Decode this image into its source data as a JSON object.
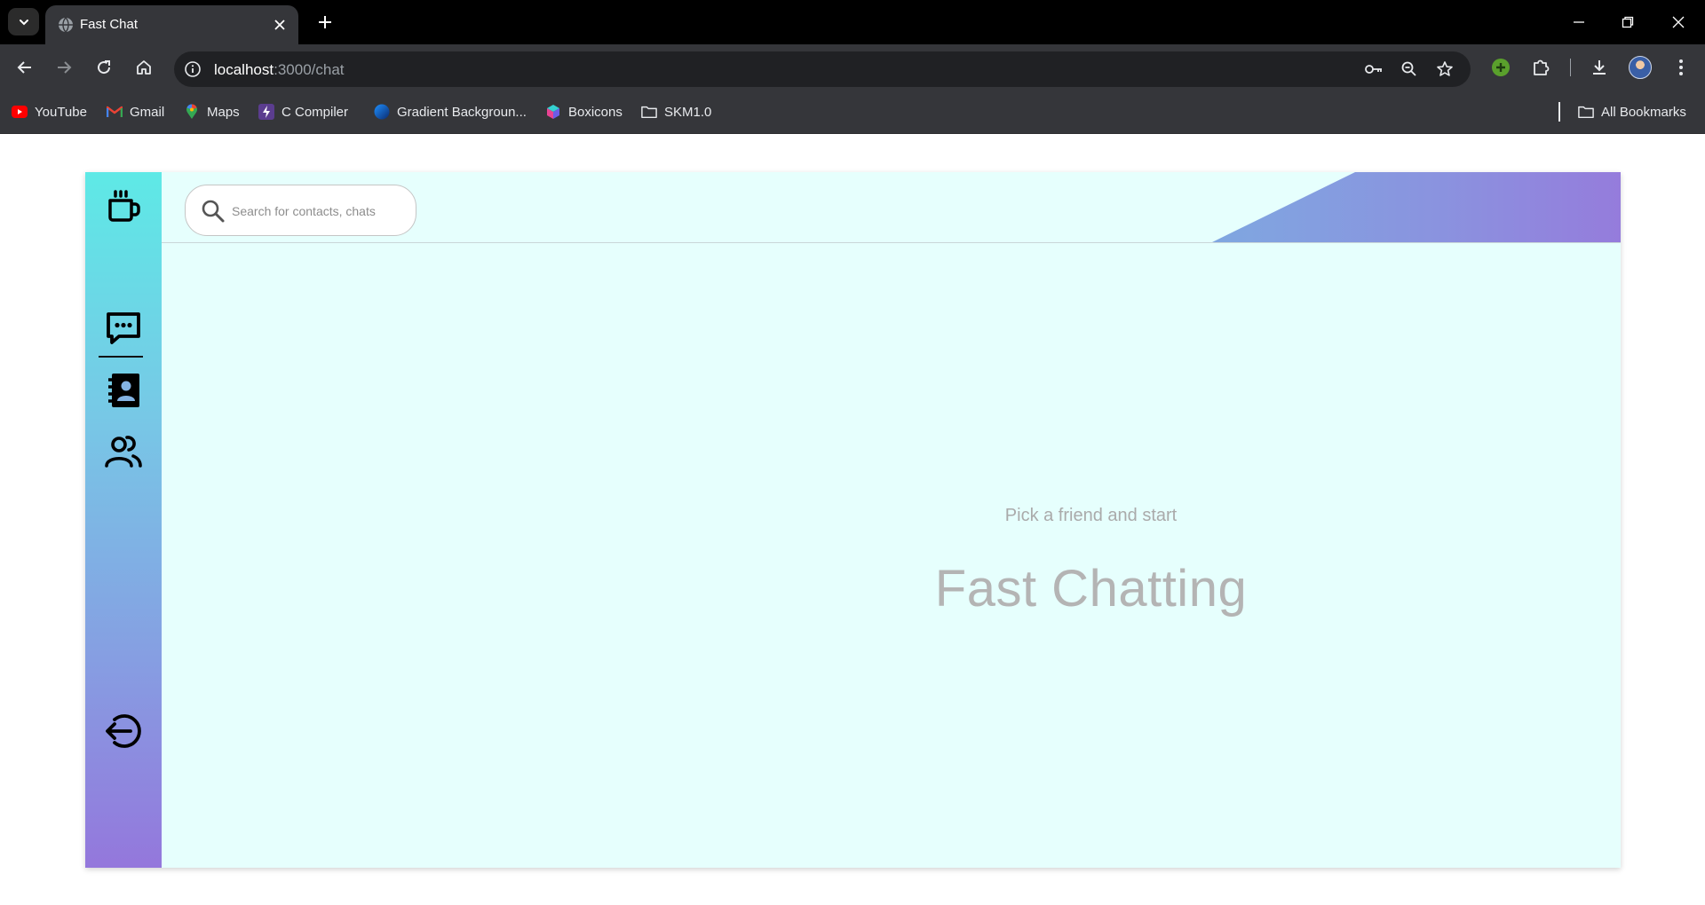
{
  "browser": {
    "tab": {
      "title": "Fast Chat"
    },
    "url": {
      "host": "localhost",
      "path": ":3000/chat"
    },
    "bookmarks": [
      {
        "label": "YouTube",
        "icon": "youtube-icon"
      },
      {
        "label": "Gmail",
        "icon": "gmail-icon"
      },
      {
        "label": "Maps",
        "icon": "maps-icon"
      },
      {
        "label": "C Compiler",
        "icon": "bolt-icon"
      },
      {
        "label": "Gradient Backgroun...",
        "icon": "globe-icon"
      },
      {
        "label": "Boxicons",
        "icon": "box-icon"
      },
      {
        "label": "SKM1.0",
        "icon": "folder-icon"
      }
    ],
    "all_bookmarks": "All Bookmarks"
  },
  "app": {
    "sidebar": {
      "items": [
        {
          "name": "logo",
          "icon": "coffee-cup-icon"
        },
        {
          "name": "chats",
          "icon": "chat-bubble-icon",
          "active": true
        },
        {
          "name": "contacts",
          "icon": "contact-book-icon"
        },
        {
          "name": "groups",
          "icon": "group-icon"
        },
        {
          "name": "logout",
          "icon": "logout-icon"
        }
      ]
    },
    "search": {
      "placeholder": "Search for contacts, chats"
    },
    "empty_state": {
      "subtitle": "Pick a friend and start",
      "title": "Fast Chatting"
    },
    "colors": {
      "sidebar_top": "#5ee9e6",
      "sidebar_bottom": "#9477dc",
      "background": "#e6fffd"
    }
  }
}
